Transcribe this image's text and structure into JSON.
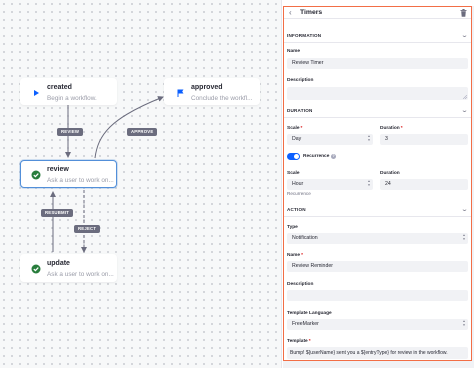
{
  "canvas": {
    "nodes": {
      "created": {
        "title": "created",
        "description": "Begin a workflow."
      },
      "approved": {
        "title": "approved",
        "description": "Conclude the workfl..."
      },
      "review": {
        "title": "review",
        "description": "Ask a user to work on..."
      },
      "update": {
        "title": "update",
        "description": "Ask a user to work on..."
      }
    },
    "transitions": {
      "review": "REVIEW",
      "approve": "APPROVE",
      "resubmit": "RESUBMIT",
      "reject": "REJECT"
    }
  },
  "sidebar": {
    "title": "Timers",
    "information": {
      "section_title": "INFORMATION",
      "name_label": "Name",
      "name_value": "Review Timer",
      "description_label": "Description",
      "description_value": ""
    },
    "duration": {
      "section_title": "DURATION",
      "scale_label": "Scale",
      "scale_value": "Day",
      "duration_label": "Duration",
      "duration_value": "3",
      "recurrence_label": "Recurrence",
      "recurrence_enabled": true,
      "recurrence_scale_label": "Scale",
      "recurrence_scale_value": "Hour",
      "recurrence_duration_label": "Duration",
      "recurrence_duration_value": "24",
      "recurrence_hint": "Recurrence"
    },
    "action": {
      "section_title": "ACTION",
      "type_label": "Type",
      "type_value": "Notification",
      "name_label": "Name",
      "name_value": "Review Reminder",
      "description_label": "Description",
      "description_value": "",
      "template_language_label": "Template Language",
      "template_language_value": "FreeMarker",
      "template_label": "Template",
      "template_value": "Bump! ${userName} sent you a ${entryType} for review in the workflow."
    }
  },
  "colors": {
    "accent_blue": "#0b5fff",
    "selected_border": "#528fd9",
    "highlight_border": "#f26e46",
    "start_icon": "#0b5fff",
    "success_icon": "#287d3c",
    "label_bg": "#6b6c7e"
  },
  "icons": {
    "start": "play-icon",
    "end": "flag-icon",
    "task": "check-circle-icon",
    "back": "chevron-left-icon",
    "delete": "trash-icon",
    "collapse": "chevron-down-icon",
    "help": "question-circle-icon"
  }
}
